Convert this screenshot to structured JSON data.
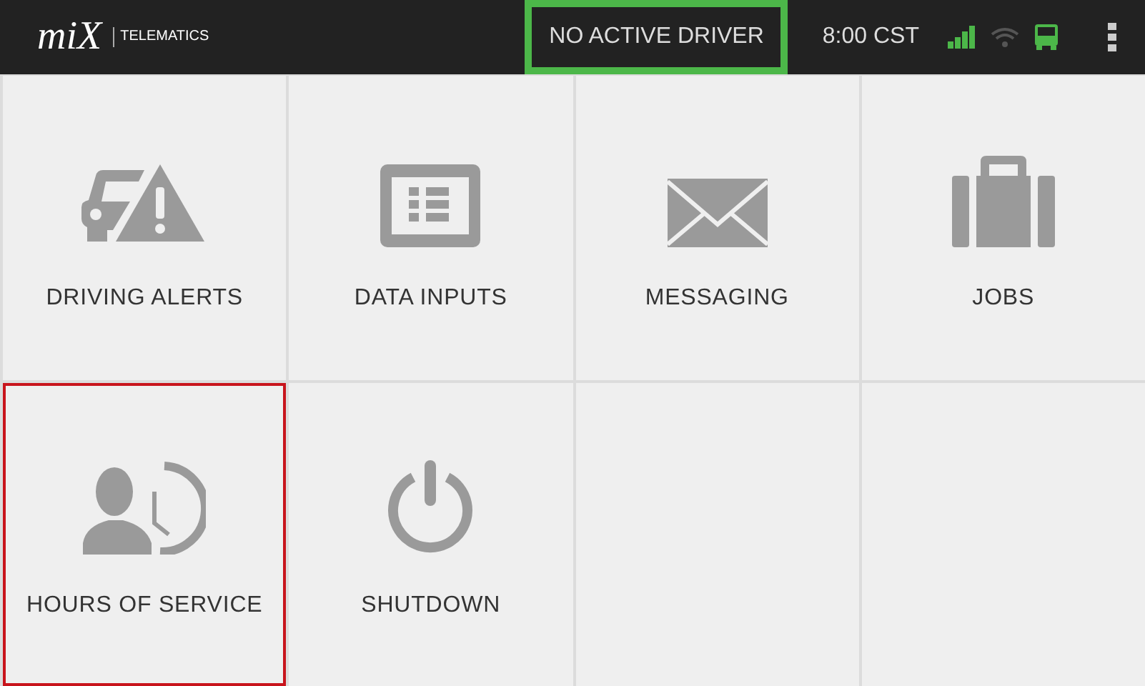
{
  "header": {
    "logo": "miX",
    "product": "TELEMATICS",
    "driver_status": {
      "label": "NO ACTIVE DRIVER",
      "highlighted": true
    },
    "time": "8:00 CST"
  },
  "tiles": [
    {
      "kind": "driving-alerts",
      "label": "DRIVING ALERTS",
      "selected": false
    },
    {
      "kind": "data-inputs",
      "label": "DATA INPUTS",
      "selected": false
    },
    {
      "kind": "messaging",
      "label": "MESSAGING",
      "selected": false
    },
    {
      "kind": "jobs",
      "label": "JOBS",
      "selected": false
    },
    {
      "kind": "hours-of-service",
      "label": "HOURS OF SERVICE",
      "selected": true
    },
    {
      "kind": "shutdown",
      "label": "SHUTDOWN",
      "selected": false
    },
    {
      "kind": "empty"
    },
    {
      "kind": "empty"
    }
  ]
}
